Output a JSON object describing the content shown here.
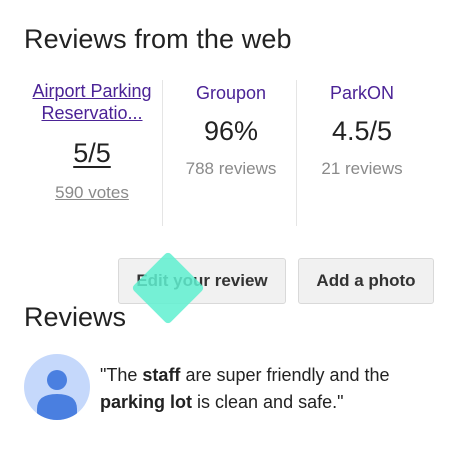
{
  "header": {
    "title": "Reviews from the web"
  },
  "sources": [
    {
      "name": "Airport Parking Reservatio...",
      "score": "5/5",
      "count": "590 votes"
    },
    {
      "name": "Groupon",
      "score": "96%",
      "count": "788 reviews"
    },
    {
      "name": "ParkON",
      "score": "4.5/5",
      "count": "21 reviews"
    }
  ],
  "actions": {
    "edit_label": "Edit your review",
    "photo_label": "Add a photo"
  },
  "reviews": {
    "title": "Reviews",
    "quote": {
      "open": "\"The ",
      "b1": "staff",
      "mid": " are super friendly and the ",
      "b2": "parking lot",
      "end": " is clean and safe.\""
    }
  },
  "colors": {
    "link": "#4b2396",
    "muted": "#8a8a8a",
    "avatar_bg": "#c5d8fb",
    "avatar_fg": "#4a7fe0"
  }
}
